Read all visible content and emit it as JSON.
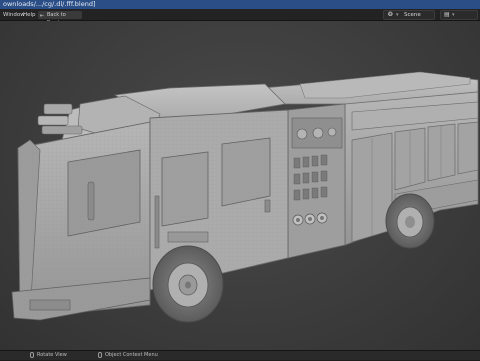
{
  "titlebar": {
    "text": "ownloads/.../cg/.dl/.fff.blend]"
  },
  "menubar": {
    "window_label": "Window",
    "help_label": "Help",
    "back_button_label": "Back to Previous",
    "scene_icon": "scene-icon",
    "scene_label": "Scene",
    "view_layer_icon": "view-layer-icon"
  },
  "statusbar": {
    "rotate_view_label": "Rotate View",
    "context_menu_label": "Object Context Menu"
  },
  "colors": {
    "title_bar": "#2b4e86",
    "viewport_bg": "#3f3f3f",
    "model_clay": "#a9a9a9"
  }
}
